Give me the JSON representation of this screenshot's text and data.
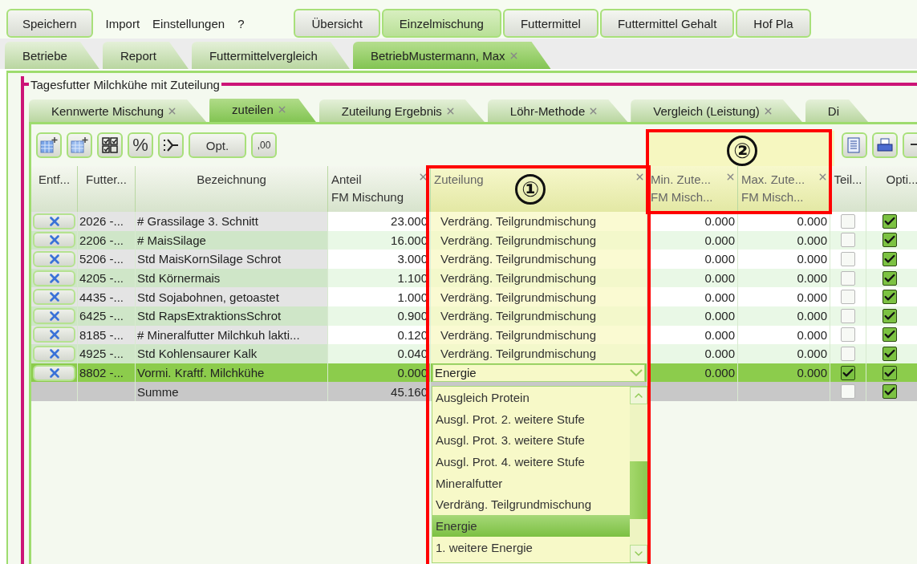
{
  "menu_bar": {
    "save_button": {
      "label": "Speichern"
    },
    "menus": [
      {
        "label": "Import"
      },
      {
        "label": "Einstellungen"
      },
      {
        "label": "?"
      }
    ],
    "views": [
      {
        "label": "Übersicht",
        "selected": false
      },
      {
        "label": "Einzelmischung",
        "selected": true
      },
      {
        "label": "Futtermittel",
        "selected": false
      },
      {
        "label": "Futtermittel Gehalt",
        "selected": false
      },
      {
        "label": "Hof Pla",
        "selected": false
      }
    ]
  },
  "document_tabs": [
    {
      "label": "Betriebe",
      "selected": false,
      "closable": false
    },
    {
      "label": "Report",
      "selected": false,
      "closable": false
    },
    {
      "label": "Futtermittelvergleich",
      "selected": false,
      "closable": false
    },
    {
      "label": "BetriebMustermann, Max",
      "selected": true,
      "closable": true
    }
  ],
  "group": {
    "title": "Tagesfutter Milchkühe mit Zuteilung",
    "tabs": [
      {
        "label": "Kennwerte Mischung",
        "selected": false,
        "closable": true
      },
      {
        "label": "zuteilen",
        "selected": true,
        "closable": true
      },
      {
        "label": "Zuteilung Ergebnis",
        "selected": false,
        "closable": true
      },
      {
        "label": "Löhr-Methode",
        "selected": false,
        "closable": true
      },
      {
        "label": "Vergleich (Leistung)",
        "selected": false,
        "closable": true
      },
      {
        "label": "Di",
        "selected": false,
        "closable": false
      }
    ],
    "toolbar": [
      {
        "kind": "table-plus"
      },
      {
        "kind": "grid-plus"
      },
      {
        "kind": "checkbox-grid"
      },
      {
        "kind": "text",
        "label": "%"
      },
      {
        "kind": "branch"
      },
      {
        "kind": "wide",
        "label": "Opt."
      },
      {
        "kind": "text",
        "label": ",00"
      }
    ],
    "toolbar_right": [
      {
        "kind": "document"
      },
      {
        "kind": "print"
      },
      {
        "kind": "minus"
      }
    ],
    "table": {
      "columns": [
        {
          "label": "Entf...",
          "closable": false,
          "highlighted": false
        },
        {
          "label": "Futter...",
          "closable": false,
          "highlighted": false
        },
        {
          "label": "Bezeichnung",
          "closable": false,
          "highlighted": false
        },
        {
          "label": "Anteil\nFM Mischung",
          "closable": true,
          "highlighted": false
        },
        {
          "label": "Zuteilung",
          "closable": true,
          "highlighted": true
        },
        {
          "label": "Min. Zute...\nFM Misch...",
          "closable": true,
          "highlighted": true
        },
        {
          "label": "Max. Zute...\nFM Misch...",
          "closable": true,
          "highlighted": true
        },
        {
          "label": "Teil...",
          "closable": false,
          "highlighted": false
        },
        {
          "label": "Opti...",
          "closable": false,
          "highlighted": false
        }
      ],
      "rows": [
        {
          "kind": "item",
          "code": "2026 -...",
          "name": "# Grassilage 3. Schnitt",
          "share": "23.000",
          "allocation": "Verdräng. Teilgrundmischung",
          "min": "0.000",
          "max": "0.000",
          "partial": false,
          "optimize": true,
          "selected": false
        },
        {
          "kind": "item",
          "code": "2206 -...",
          "name": "# MaisSilage",
          "share": "16.000",
          "allocation": "Verdräng. Teilgrundmischung",
          "min": "0.000",
          "max": "0.000",
          "partial": false,
          "optimize": true,
          "selected": false
        },
        {
          "kind": "item",
          "code": "5206 -...",
          "name": "Std MaisKornSilage Schrot",
          "share": "3.000",
          "allocation": "Verdräng. Teilgrundmischung",
          "min": "0.000",
          "max": "0.000",
          "partial": false,
          "optimize": true,
          "selected": false
        },
        {
          "kind": "item",
          "code": "4205 -...",
          "name": "Std Körnermais",
          "share": "1.100",
          "allocation": "Verdräng. Teilgrundmischung",
          "min": "0.000",
          "max": "0.000",
          "partial": false,
          "optimize": true,
          "selected": false
        },
        {
          "kind": "item",
          "code": "4435 -...",
          "name": "Std Sojabohnen, getoastet",
          "share": "1.000",
          "allocation": "Verdräng. Teilgrundmischung",
          "min": "0.000",
          "max": "0.000",
          "partial": false,
          "optimize": true,
          "selected": false
        },
        {
          "kind": "item",
          "code": "6425 -...",
          "name": "Std RapsExtraktionsSchrot",
          "share": "0.900",
          "allocation": "Verdräng. Teilgrundmischung",
          "min": "0.000",
          "max": "0.000",
          "partial": false,
          "optimize": true,
          "selected": false
        },
        {
          "kind": "item",
          "code": "8185 -...",
          "name": "# Mineralfutter Milchkuh lakti...",
          "share": "0.120",
          "allocation": "Verdräng. Teilgrundmischung",
          "min": "0.000",
          "max": "0.000",
          "partial": false,
          "optimize": true,
          "selected": false
        },
        {
          "kind": "item",
          "code": "4925 -...",
          "name": "Std Kohlensaurer Kalk",
          "share": "0.040",
          "allocation": "Verdräng. Teilgrundmischung",
          "min": "0.000",
          "max": "0.000",
          "partial": false,
          "optimize": true,
          "selected": false
        },
        {
          "kind": "editing",
          "code": "8802 -...",
          "name": "Vormi. Kraftf. Milchkühe",
          "share": "0.000",
          "allocation": "Energie",
          "min": "0.000",
          "max": "0.000",
          "partial": true,
          "optimize": true,
          "selected": true
        },
        {
          "kind": "sum",
          "name": "Summe",
          "share": "45.160",
          "partial": false,
          "optimize": true,
          "selected": false
        }
      ]
    },
    "dropdown": {
      "options": [
        {
          "label": "Ausgleich Protein",
          "selected": false
        },
        {
          "label": "Ausgl. Prot. 2. weitere Stufe",
          "selected": false
        },
        {
          "label": "Ausgl. Prot. 3. weitere Stufe",
          "selected": false
        },
        {
          "label": "Ausgl. Prot. 4. weitere Stufe",
          "selected": false
        },
        {
          "label": "Mineralfutter",
          "selected": false
        },
        {
          "label": "Verdräng. Teilgrundmischung",
          "selected": false
        },
        {
          "label": "Energie",
          "selected": true
        },
        {
          "label": "1. weitere Energie",
          "selected": false
        }
      ]
    }
  },
  "annotations": [
    {
      "label": "①",
      "kind": "column-frame"
    },
    {
      "label": "②",
      "kind": "header-frame"
    }
  ]
}
